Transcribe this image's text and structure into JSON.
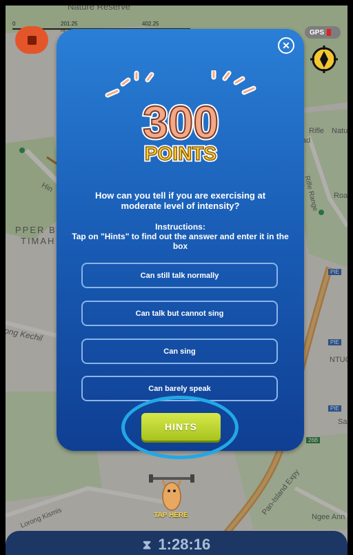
{
  "map": {
    "scale_labels": [
      "0",
      "201.25 m",
      "402.25 m"
    ],
    "labels": [
      "Nature Reserve",
      "Rifle Range Rd",
      "PPER B",
      "TIMAH",
      "Hin",
      "ong Kechil",
      "Pan-Island Expy",
      "Lorong Kismis",
      "Ngee Ann",
      "Rifle",
      "Natur",
      "ifle",
      "ad",
      "Roa",
      "NTUC",
      "Sa",
      "PIE",
      "26B"
    ],
    "gps_label": "GPS"
  },
  "popup": {
    "points_number": "300",
    "points_word": "POINTS",
    "question": "How can you tell if you are exercising at moderate level of intensity?",
    "instructions_title": "Instructions:",
    "instructions_body": "Tap on \"Hints\" to find out the answer and enter it in the box",
    "options": [
      "Can still talk normally",
      "Can talk but cannot sing",
      "Can sing",
      "Can barely speak"
    ],
    "hints_label": "HINTS"
  },
  "mascot": {
    "tap_label": "TAP HERE"
  },
  "timer": {
    "value": "1:28:16"
  },
  "colors": {
    "popup_top": "#2a7fd6",
    "popup_bottom": "#0f3f93",
    "hints_button": "#bcd530",
    "highlight_ring": "#22a8e6",
    "stop_button": "#e4552a",
    "points_fill": "#f3a987",
    "points_word_fill": "#f7d23a"
  },
  "icons": [
    "stop-icon",
    "close-icon",
    "compass-icon",
    "hourglass-icon",
    "mascot-icon"
  ]
}
